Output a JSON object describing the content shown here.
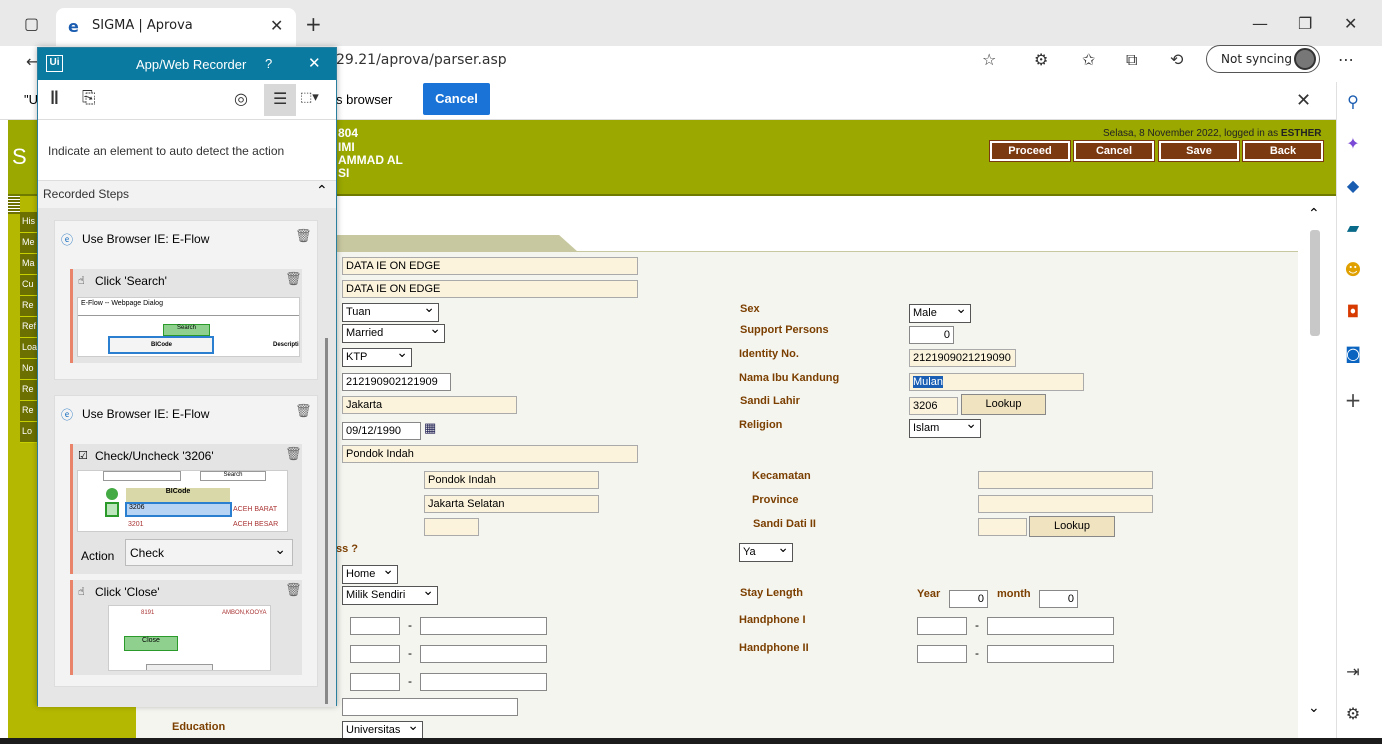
{
  "browser": {
    "tab_title": "SIGMA | Aprova",
    "url": "29.21/aprova/parser.asp",
    "sync_label": "Not syncing"
  },
  "infobar": {
    "left_text": "\"U",
    "mid_text": "s browser",
    "cancel_label": "Cancel"
  },
  "header": {
    "id_line": "804",
    "name1": "IMI",
    "name2": "AMMAD AL",
    "name3": "SI",
    "login_text": "Selasa, 8 November 2022, logged in as",
    "login_user": "ESTHER",
    "buttons": [
      "Proceed",
      "Cancel",
      "Save",
      "Back"
    ]
  },
  "nav": {
    "items": [
      "His",
      "Me",
      "Ma",
      "Cu",
      "Re",
      "Ref",
      "Loa",
      "No",
      "Re",
      "Re",
      "Lo"
    ]
  },
  "form": {
    "name1": "DATA IE ON EDGE",
    "name2": "DATA IE ON EDGE",
    "title": "Tuan",
    "marital": "Married",
    "id_type": "KTP",
    "id_num": "212190902121909",
    "birth_place": "Jakarta",
    "birth_date": "09/12/1990",
    "address": "Pondok Indah",
    "addr_area": "Pondok Indah",
    "addr_city": "Jakarta Selatan",
    "addr_label": "ss ?",
    "addr_yn": "Ya",
    "home": "Home",
    "ownership": "Milik Sendiri",
    "education_label": "Education",
    "education": "Universitas",
    "sex_label": "Sex",
    "sex": "Male",
    "support_label": "Support Persons",
    "support": "0",
    "identity_label": "Identity No.",
    "identity": "2121909021219090",
    "mother_label": "Nama Ibu Kandung",
    "mother": "Mulan",
    "sandi_lahir_label": "Sandi Lahir",
    "sandi_lahir": "3206",
    "lookup": "Lookup",
    "religion_label": "Religion",
    "religion": "Islam",
    "kecamatan_label": "Kecamatan",
    "province_label": "Province",
    "sandi_dati_label": "Sandi Dati II",
    "stay_label": "Stay Length",
    "year_label": "Year",
    "year": "0",
    "month_label": "month",
    "month": "0",
    "hp1_label": "Handphone I",
    "hp2_label": "Handphone II",
    "dash": "-"
  },
  "recorder": {
    "title": "App/Web Recorder",
    "help": "?",
    "instruction": "Indicate an element to auto detect the action",
    "steps_header": "Recorded Steps",
    "step1": {
      "title": "Use Browser IE: E-Flow",
      "action": "Click 'Search'",
      "thumb_title": "E-Flow -- Webpage Dialog",
      "thumb_btn": "Search",
      "thumb_col1": "BICode",
      "thumb_col2": "Descripti"
    },
    "step2": {
      "title": "Use Browser IE: E-Flow",
      "action": "Check/Uncheck '3206'",
      "thumb_btn": "Search",
      "thumb_col": "BICode",
      "thumb_r1a": "3206",
      "thumb_r1b": "ACEH BARAT",
      "thumb_r2a": "3201",
      "thumb_r2b": "ACEH BESAR",
      "action_label": "Action",
      "action_value": "Check"
    },
    "step3": {
      "action": "Click 'Close'",
      "thumb_r1a": "8191",
      "thumb_r1b": "AMBON,KOOYA",
      "thumb_btn": "Close"
    }
  },
  "colors": {
    "olive": "#9aa800",
    "brown": "#7b3a10",
    "recorder_blue": "#0a7aa0",
    "cancel_blue": "#1a73d6"
  }
}
